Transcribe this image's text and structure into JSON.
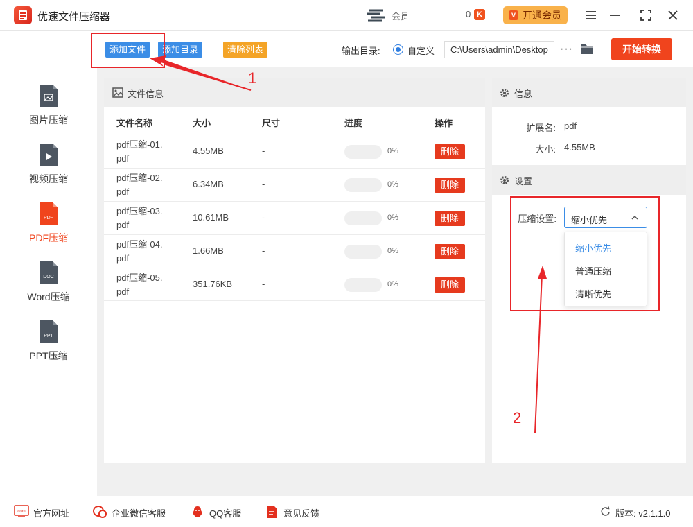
{
  "app": {
    "title": "优速文件压缩器",
    "watermark_text": "会员",
    "partial_text": "0"
  },
  "titlebar": {
    "vip_label": "开通会员",
    "vip_icon_letter": "V",
    "k_icon_letter": "K"
  },
  "toolbar": {
    "add_file": "添加文件",
    "add_folder": "添加目录",
    "clear_list": "清除列表",
    "output_label": "输出目录:",
    "radio_label": "自定义",
    "output_path": "C:\\Users\\admin\\Desktop",
    "more": "···",
    "start": "开始转换"
  },
  "sidebar": {
    "items": [
      {
        "label": "图片压缩",
        "icon_text": ""
      },
      {
        "label": "视频压缩",
        "icon_text": ""
      },
      {
        "label": "PDF压缩",
        "icon_text": "PDF"
      },
      {
        "label": "Word压缩",
        "icon_text": "DOC"
      },
      {
        "label": "PPT压缩",
        "icon_text": "PPT"
      }
    ]
  },
  "file_panel": {
    "title": "文件信息",
    "columns": {
      "name": "文件名称",
      "size": "大小",
      "dim": "尺寸",
      "progress": "进度",
      "action": "操作"
    },
    "rows": [
      {
        "name_line1": "pdf压缩-01.",
        "name_line2": "pdf",
        "size": "4.55MB",
        "dim": "-",
        "progress": 0,
        "progress_text": "0%",
        "action": "删除"
      },
      {
        "name_line1": "pdf压缩-02.",
        "name_line2": "pdf",
        "size": "6.34MB",
        "dim": "-",
        "progress": 0,
        "progress_text": "0%",
        "action": "删除"
      },
      {
        "name_line1": "pdf压缩-03.",
        "name_line2": "pdf",
        "size": "10.61MB",
        "dim": "-",
        "progress": 0,
        "progress_text": "0%",
        "action": "删除"
      },
      {
        "name_line1": "pdf压缩-04.",
        "name_line2": "pdf",
        "size": "1.66MB",
        "dim": "-",
        "progress": 0,
        "progress_text": "0%",
        "action": "删除"
      },
      {
        "name_line1": "pdf压缩-05.",
        "name_line2": "pdf",
        "size": "351.76KB",
        "dim": "-",
        "progress": 0,
        "progress_text": "0%",
        "action": "删除"
      }
    ]
  },
  "info_panel": {
    "title": "信息",
    "ext_label": "扩展名:",
    "ext_value": "pdf",
    "size_label": "大小:",
    "size_value": "4.55MB",
    "settings_title": "设置",
    "compress_label": "压缩设置:",
    "compress_value": "缩小优先",
    "options": [
      "缩小优先",
      "普通压缩",
      "清晰优先"
    ]
  },
  "statusbar": {
    "website": "官方网址",
    "website_icon_text": "com",
    "wechat": "企业微信客服",
    "qq": "QQ客服",
    "feedback": "意见反馈",
    "version": "版本: v2.1.1.0"
  },
  "annotations": {
    "step1": "1",
    "step2": "2"
  },
  "colors": {
    "accent_blue": "#3b8de6",
    "accent_red": "#f0441d",
    "accent_orange": "#f4a427",
    "vip": "#f9b24b",
    "annotation_red": "#e8262a"
  }
}
